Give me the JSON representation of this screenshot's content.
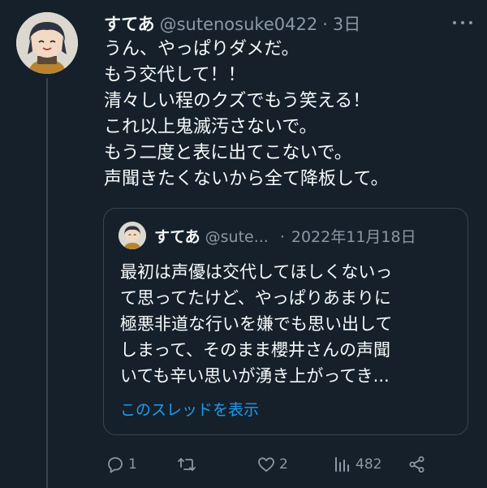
{
  "tweet": {
    "display_name": "すてあ",
    "handle": "@sutenosuke0422",
    "separator": "·",
    "time": "3日",
    "lines": [
      "うん、やっぱりダメだ。",
      "もう交代して！！",
      "清々しい程のクズでもう笑える！",
      "これ以上鬼滅汚さないで。",
      "もう二度と表に出てこないで。",
      "声聞きたくないから全て降板して。"
    ]
  },
  "quoted": {
    "display_name": "すてあ",
    "handle": "@sute...",
    "separator": "·",
    "date": "2022年11月18日",
    "lines": [
      "最初は声優は交代してほしくないっ",
      "て思ってたけど、やっぱりあまりに",
      "極悪非道な行いを嫌でも思い出して",
      "しまって、そのまま櫻井さんの声聞",
      "いても辛い思いが湧き上がってき..."
    ],
    "show_thread": "このスレッドを表示"
  },
  "actions": {
    "reply_count": "1",
    "retweet_count": "",
    "like_count": "2",
    "view_count": "482"
  },
  "icons": [
    "more-icon",
    "reply-icon",
    "retweet-icon",
    "like-icon",
    "views-icon",
    "share-icon"
  ],
  "colors": {
    "background": "#15202b",
    "text": "#f7f9f9",
    "muted": "#8b98a5",
    "border": "#38444d",
    "link": "#1d9bf0"
  }
}
